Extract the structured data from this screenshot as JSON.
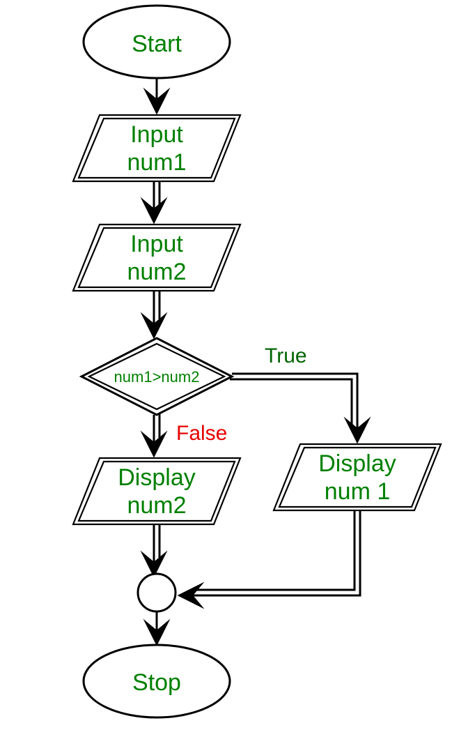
{
  "nodes": {
    "start": "Start",
    "input1_l1": "Input",
    "input1_l2": "num1",
    "input2_l1": "Input",
    "input2_l2": "num2",
    "cond": "num1>num2",
    "true_label": "True",
    "false_label": "False",
    "disp2_l1": "Display",
    "disp2_l2": "num2",
    "disp1_l1": "Display",
    "disp1_l2": "num 1",
    "stop": "Stop"
  }
}
